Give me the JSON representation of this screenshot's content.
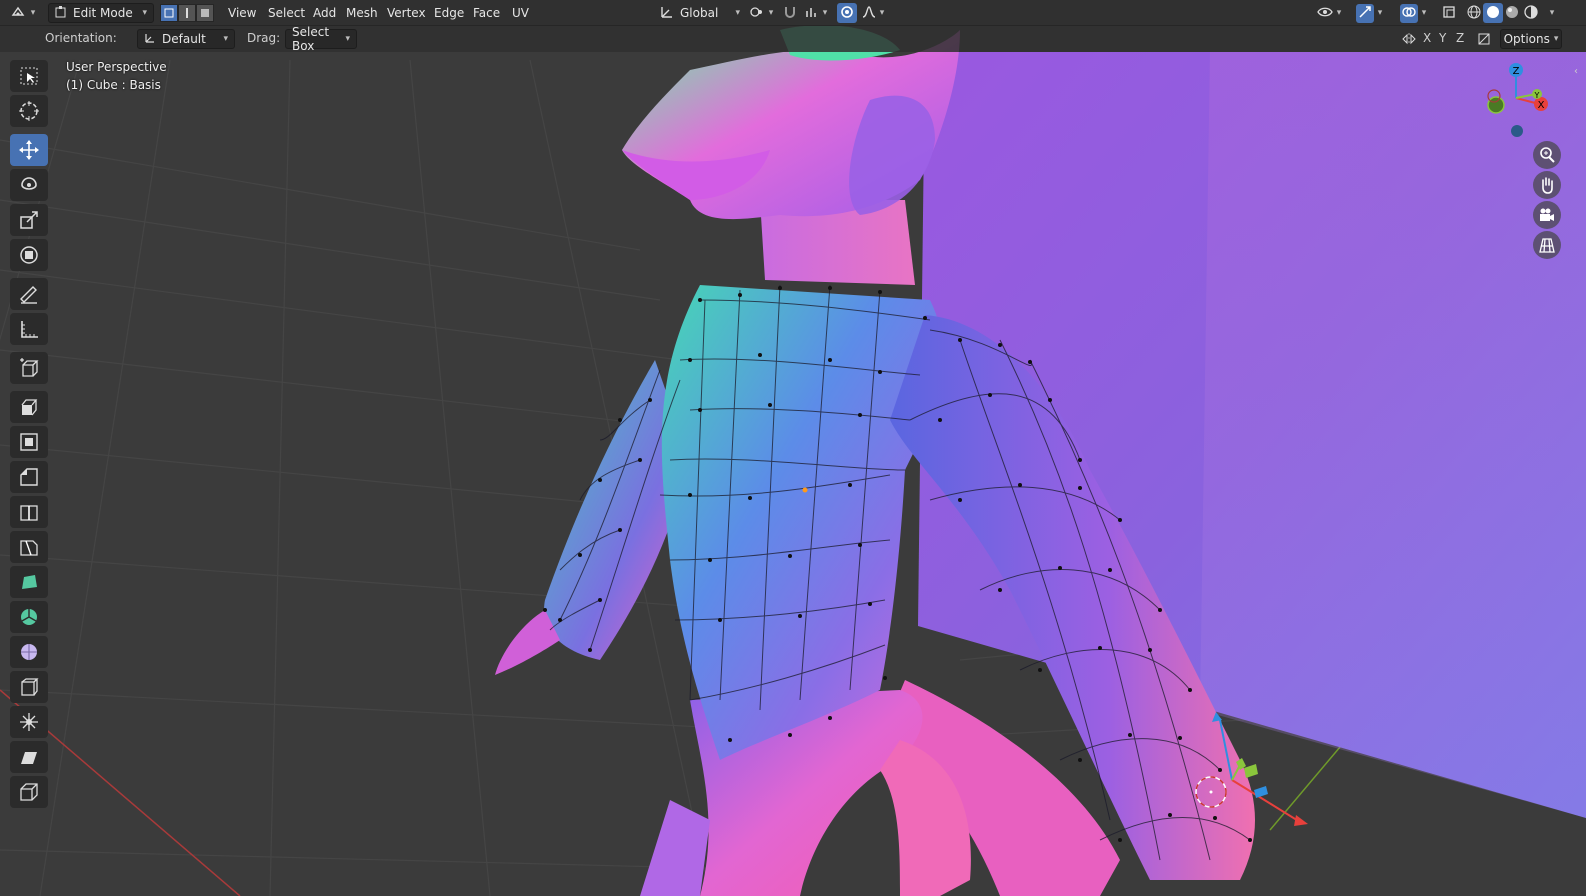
{
  "header": {
    "editor_type_icon": "editor-type-icon",
    "mode_dropdown": "Edit Mode",
    "menus": [
      "View",
      "Select",
      "Add",
      "Mesh",
      "Vertex",
      "Edge",
      "Face",
      "UV"
    ],
    "transform_orientation": "Global",
    "select_modes": [
      "vertex",
      "edge",
      "face"
    ]
  },
  "tool_settings": {
    "orientation_label": "Orientation:",
    "orientation_value": "Default",
    "drag_label": "Drag:",
    "drag_value": "Select Box",
    "axis_x": "X",
    "axis_y": "Y",
    "axis_z": "Z",
    "options_label": "Options"
  },
  "viewport": {
    "perspective_label": "User Perspective",
    "object_label": "(1) Cube : Basis"
  },
  "gizmo": {
    "x_label": "X",
    "y_label": "Y",
    "z_label": "Z",
    "x_color": "#e8403c",
    "y_color": "#8ac63c",
    "z_color": "#2f8fe0"
  },
  "toolbox": [
    {
      "name": "select-box-tool",
      "icon": "select-box-icon",
      "active": false
    },
    {
      "name": "cursor-tool",
      "icon": "cursor-icon",
      "active": false
    },
    {
      "name": "move-tool",
      "icon": "move-icon",
      "active": true
    },
    {
      "name": "rotate-tool",
      "icon": "rotate-icon",
      "active": false
    },
    {
      "name": "scale-tool",
      "icon": "scale-icon",
      "active": false
    },
    {
      "name": "transform-tool",
      "icon": "transform-icon",
      "active": false
    },
    {
      "name": "annotate-tool",
      "icon": "annotate-icon",
      "active": false
    },
    {
      "name": "measure-tool",
      "icon": "measure-icon",
      "active": false
    },
    {
      "name": "add-cube-tool",
      "icon": "add-cube-icon",
      "active": false
    },
    {
      "name": "extrude-tool",
      "icon": "extrude-icon",
      "active": false
    },
    {
      "name": "inset-tool",
      "icon": "inset-icon",
      "active": false
    },
    {
      "name": "bevel-tool",
      "icon": "bevel-icon",
      "active": false
    },
    {
      "name": "loop-cut-tool",
      "icon": "loop-cut-icon",
      "active": false
    },
    {
      "name": "knife-tool",
      "icon": "knife-icon",
      "active": false
    },
    {
      "name": "poly-build-tool",
      "icon": "poly-build-icon",
      "active": false
    },
    {
      "name": "spin-tool",
      "icon": "spin-icon",
      "active": false
    },
    {
      "name": "smooth-tool",
      "icon": "smooth-icon",
      "active": false
    },
    {
      "name": "edge-slide-tool",
      "icon": "edge-slide-icon",
      "active": false
    },
    {
      "name": "shrink-fatten-tool",
      "icon": "shrink-fatten-icon",
      "active": false
    },
    {
      "name": "shear-tool",
      "icon": "shear-icon",
      "active": false
    },
    {
      "name": "rip-region-tool",
      "icon": "rip-region-icon",
      "active": false
    }
  ],
  "nav_buttons": [
    "zoom-icon",
    "pan-hand-icon",
    "camera-icon",
    "ortho-grid-icon"
  ],
  "colors": {
    "active_blue": "#4772b3",
    "header_bg": "#303030",
    "grid_floor": "#3a3a3a"
  }
}
